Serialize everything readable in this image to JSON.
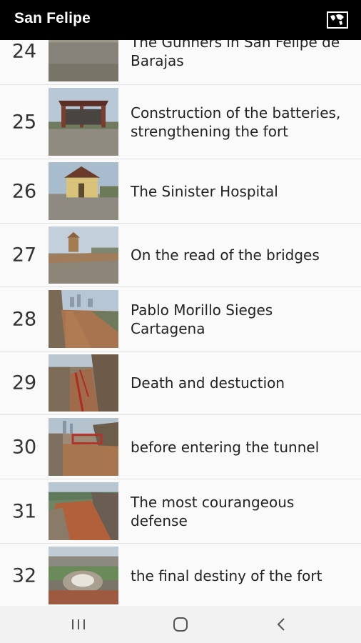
{
  "app": {
    "title": "San Felipe",
    "action_icon": "map-icon"
  },
  "stops": [
    {
      "number": "24",
      "title": "The Gunners in San Felipe de Barajas",
      "image": "gun-platform-photo"
    },
    {
      "number": "25",
      "title": "Construction of the batteries, strengthening the fort",
      "image": "roofed-shelter-photo"
    },
    {
      "number": "26",
      "title": "The Sinister Hospital",
      "image": "yellow-hut-photo"
    },
    {
      "number": "27",
      "title": "On the read of the bridges",
      "image": "sentry-box-photo"
    },
    {
      "number": "28",
      "title": "Pablo Morillo Sieges Cartagena",
      "image": "wall-walkway-photo"
    },
    {
      "number": "29",
      "title": "Death and destuction",
      "image": "red-railing-ramp-photo"
    },
    {
      "number": "30",
      "title": "before entering the tunnel",
      "image": "tunnel-approach-photo"
    },
    {
      "number": "31",
      "title": "The most courangeous defense",
      "image": "sloped-wall-photo"
    },
    {
      "number": "32",
      "title": "the final destiny of the fort",
      "image": "fort-ruins-photo"
    }
  ],
  "system_nav": {
    "recents_icon": "recents-icon",
    "home_icon": "home-icon",
    "back_icon": "back-icon"
  }
}
